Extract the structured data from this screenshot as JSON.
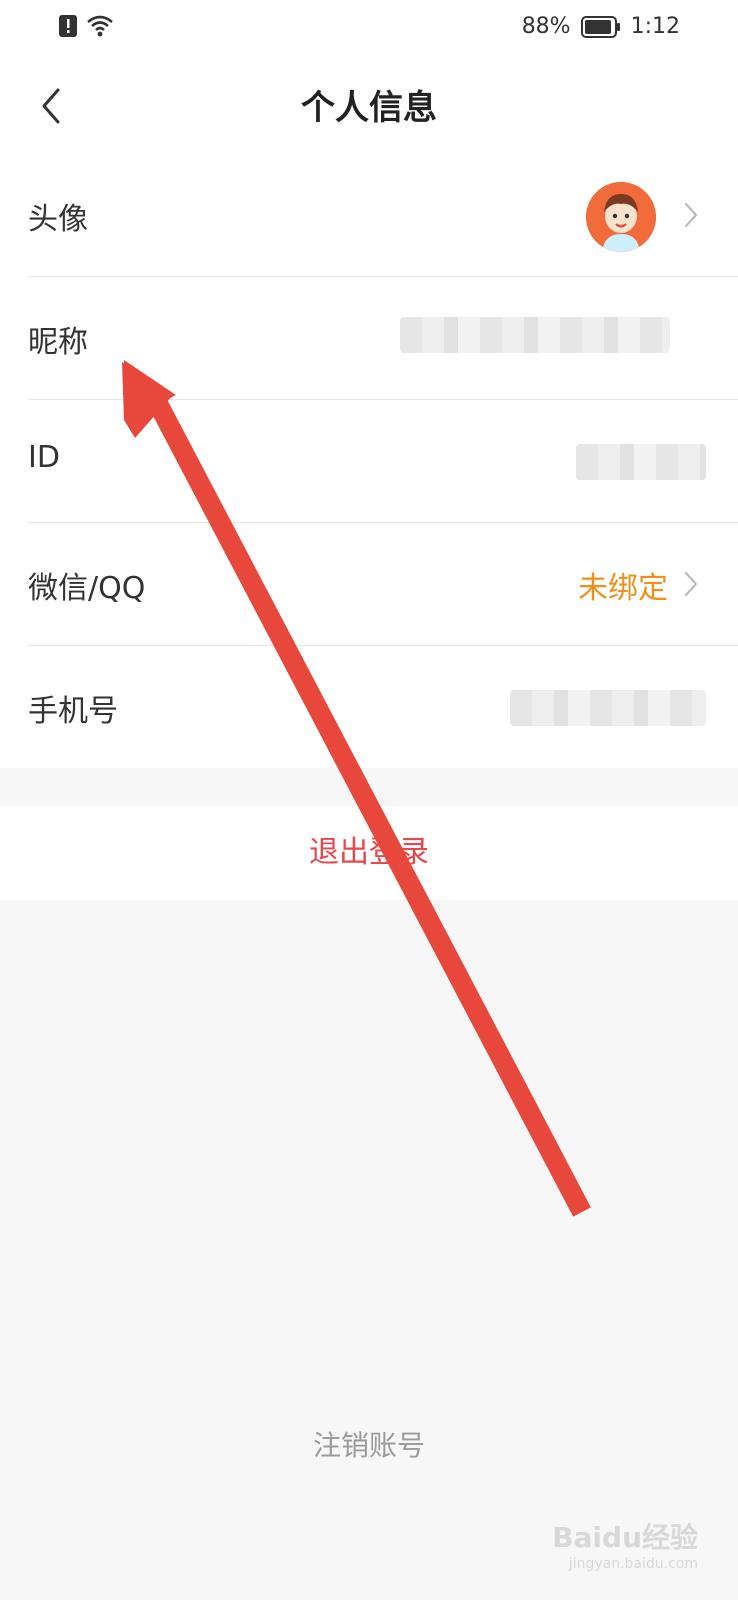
{
  "status_bar": {
    "battery_percent": "88%",
    "time": "1:12"
  },
  "header": {
    "title": "个人信息"
  },
  "rows": [
    {
      "label": "头像"
    },
    {
      "label": "昵称"
    },
    {
      "label": "ID"
    },
    {
      "label": "微信/QQ",
      "value": "未绑定"
    },
    {
      "label": "手机号"
    }
  ],
  "logout_label": "退出登录",
  "cancel_account_label": "注销账号",
  "watermark": {
    "brand": "Baidu经验",
    "url": "jingyan.baidu.com"
  },
  "colors": {
    "accent_orange": "#f0901a",
    "logout_red": "#e8474b",
    "arrow_red": "#e8473b"
  }
}
